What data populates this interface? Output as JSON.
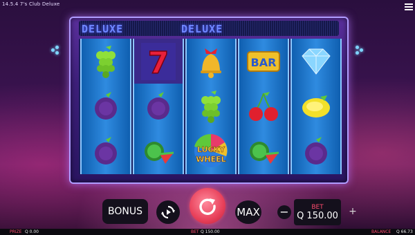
{
  "window": {
    "title": "14.5.4 7's Club Deluxe"
  },
  "header": {
    "deluxe_left": "DELUXE",
    "deluxe_right": "DELUXE"
  },
  "reels": [
    [
      "grapes",
      "plum",
      "plum"
    ],
    [
      "seven",
      "plum",
      "watermelon"
    ],
    [
      "bell",
      "grapes",
      "lucky-wheel"
    ],
    [
      "bar",
      "cherries",
      "watermelon"
    ],
    [
      "diamond",
      "lemon",
      "plum"
    ]
  ],
  "symbols": {
    "bar_text": "BAR",
    "seven_text": "7",
    "lucky_wheel_line1": "LUCKY",
    "lucky_wheel_line2": "WHEEL"
  },
  "controls": {
    "bonus_label": "BONUS",
    "max_label": "MAX",
    "minus_label": "−",
    "plus_label": "+",
    "bet_label": "BET",
    "bet_value": "Q 150.00"
  },
  "footer": {
    "prize_label": "PRIZE",
    "prize_value": "Q 0.00",
    "bet_label": "BET",
    "bet_value": "Q 150.00",
    "balance_label": "BALANCE",
    "balance_value": "Q 66.73"
  },
  "icons": {
    "menu": "hamburger-menu-icon",
    "autoplay": "autoplay-icon",
    "spin": "spin-icon"
  }
}
